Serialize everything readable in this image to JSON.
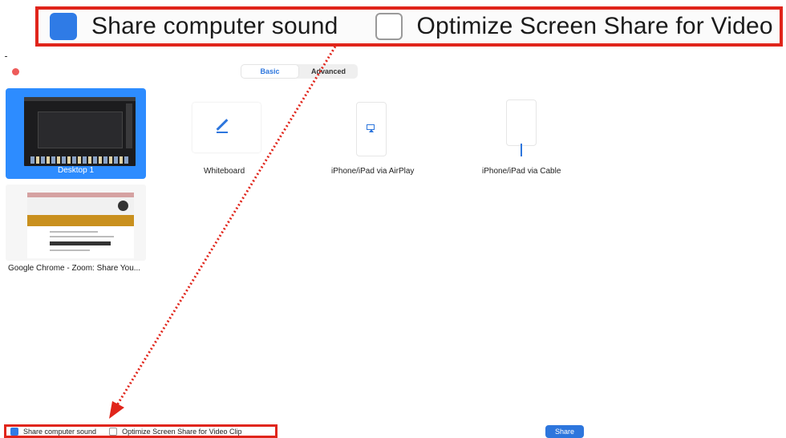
{
  "callout": {
    "share_sound_label": "Share computer sound",
    "optimize_label": "Optimize Screen Share for Video Clip",
    "share_sound_checked": true,
    "optimize_checked": false
  },
  "tabs": [
    {
      "label": "Basic",
      "active": true
    },
    {
      "label": "Advanced",
      "active": false
    }
  ],
  "sources": {
    "desktop": {
      "label": "Desktop 1",
      "selected": true
    },
    "chrome": {
      "label": "Google Chrome - Zoom: Share You..."
    },
    "whiteboard": {
      "label": "Whiteboard"
    },
    "airplay": {
      "label": "iPhone/iPad via AirPlay"
    },
    "cable": {
      "label": "iPhone/iPad via Cable"
    }
  },
  "footer": {
    "share_sound_label": "Share computer sound",
    "optimize_label": "Optimize Screen Share for Video Clip",
    "share_button": "Share"
  },
  "colors": {
    "accent": "#2d76dd",
    "selected_tile": "#2d8cff",
    "highlight_border": "#e0251b",
    "window_close": "#ee5b5a"
  },
  "icons": {
    "whiteboard": "pencil-icon",
    "airplay": "airplay-icon",
    "cable": "lightning-cable-icon"
  }
}
